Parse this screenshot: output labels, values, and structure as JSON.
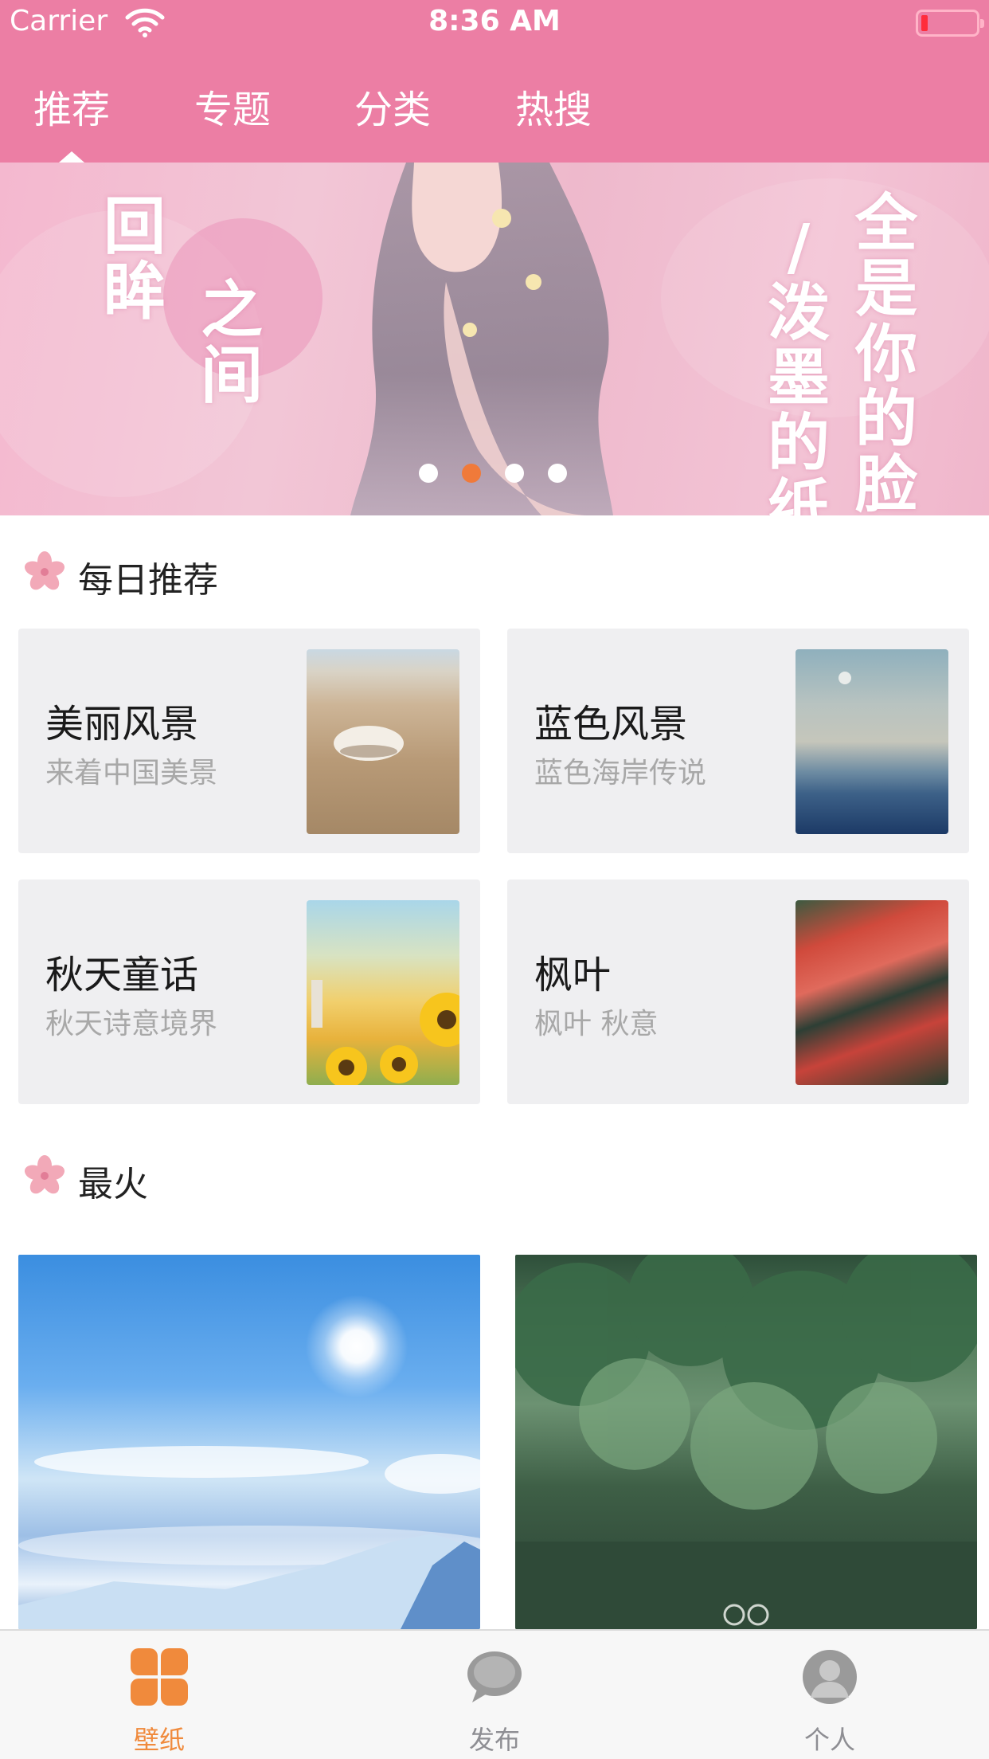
{
  "status_bar": {
    "carrier": "Carrier",
    "time": "8:36 AM",
    "battery_color": "#ff2d3c"
  },
  "top_tabs": [
    {
      "label": "推荐",
      "selected": true
    },
    {
      "label": "专题",
      "selected": false
    },
    {
      "label": "分类",
      "selected": false
    },
    {
      "label": "热搜",
      "selected": false
    }
  ],
  "banner": {
    "title_left_1": "回眸",
    "title_left_2": "之间",
    "title_right_1": "/泼墨的纸",
    "title_right_2": "全是你的脸",
    "page_count": 4,
    "active_page": 2
  },
  "sections": {
    "daily": {
      "title": "每日推荐",
      "icon": "sakura-icon",
      "cards": [
        {
          "title": "美丽风景",
          "subtitle": "来着中国美景"
        },
        {
          "title": "蓝色风景",
          "subtitle": "蓝色海岸传说"
        },
        {
          "title": "秋天童话",
          "subtitle": "秋天诗意境界"
        },
        {
          "title": "枫叶",
          "subtitle": "枫叶 秋意"
        }
      ]
    },
    "hot": {
      "title": "最火",
      "icon": "sakura-icon"
    }
  },
  "tab_bar": {
    "items": [
      {
        "label": "壁纸",
        "icon": "clover-icon",
        "active": true
      },
      {
        "label": "发布",
        "icon": "speech-bubble-icon",
        "active": false
      },
      {
        "label": "个人",
        "icon": "person-icon",
        "active": false
      }
    ]
  },
  "colors": {
    "header": "#ec7ea4",
    "accent": "#f08a3c",
    "card_bg": "#efeff1"
  }
}
